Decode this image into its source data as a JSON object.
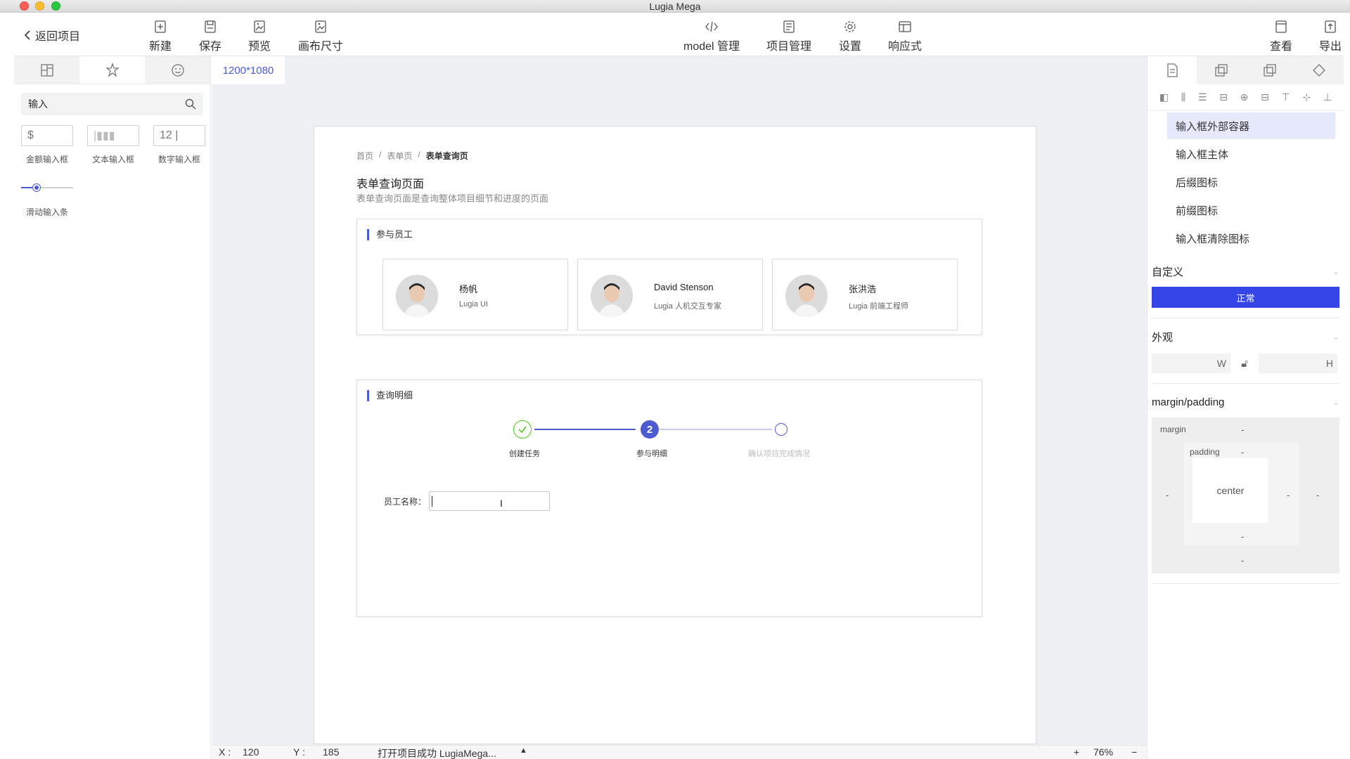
{
  "window": {
    "title": "Lugia Mega"
  },
  "toolbar": {
    "back_label": "返回项目",
    "left_items": [
      {
        "label": "新建",
        "icon": "new-file-icon"
      },
      {
        "label": "保存",
        "icon": "save-icon"
      },
      {
        "label": "预览",
        "icon": "preview-icon"
      },
      {
        "label": "画布尺寸",
        "icon": "canvas-size-icon"
      }
    ],
    "center_items": [
      {
        "label": "model 管理",
        "icon": "code-icon"
      },
      {
        "label": "项目管理",
        "icon": "project-icon"
      },
      {
        "label": "设置",
        "icon": "gear-icon"
      },
      {
        "label": "响应式",
        "icon": "layout-icon"
      }
    ],
    "right_items": [
      {
        "label": "查看",
        "icon": "view-icon"
      },
      {
        "label": "导出",
        "icon": "export-icon"
      }
    ]
  },
  "left_panel": {
    "tabs": [
      "grid-icon",
      "widget-icon",
      "smile-icon"
    ],
    "search": {
      "value": "输入"
    },
    "components": [
      {
        "preview": "$",
        "label": "金额输入框"
      },
      {
        "preview": "|▮▮▮",
        "label": "文本输入框"
      },
      {
        "preview": "12 |",
        "label": "数字输入框"
      }
    ],
    "slider": {
      "label": "滑动输入条",
      "value": 0.3
    }
  },
  "canvas": {
    "size_tab": "1200*1080",
    "breadcrumb": [
      "首页",
      "表单页",
      "表单查询页"
    ],
    "page_title": "表单查询页面",
    "page_desc": "表单查询页面是查询整体项目细节和进度的页面",
    "employees_card": {
      "title": "参与员工",
      "employees": [
        {
          "name": "杨帆",
          "role": "Lugia UI"
        },
        {
          "name": "David Stenson",
          "role": "Lugia 人机交互专家"
        },
        {
          "name": "张洪浩",
          "role": "Lugia 前端工程师"
        }
      ]
    },
    "detail_card": {
      "title": "查询明细",
      "steps": [
        {
          "label": "创建任务",
          "status": "done"
        },
        {
          "label": "参与明细",
          "status": "active",
          "number": "2"
        },
        {
          "label": "确认项目完成情况",
          "status": "wait"
        }
      ],
      "form": {
        "label": "员工名称：",
        "value": ""
      }
    }
  },
  "right_panel": {
    "tabs": [
      "page-icon",
      "copy-icon",
      "duplicate-icon",
      "diamond-icon"
    ],
    "parts": [
      "输入框外部容器",
      "输入框主体",
      "后缀图标",
      "前缀图标",
      "输入框清除图标"
    ],
    "selected_part_index": 0,
    "custom": {
      "title": "自定义",
      "status": "正常"
    },
    "appearance": {
      "title": "外观",
      "w_label": "W",
      "h_label": "H"
    },
    "box_model": {
      "title": "margin/padding",
      "margin_label": "margin",
      "padding_label": "padding",
      "content_label": "center",
      "empty": "-"
    }
  },
  "statusbar": {
    "x_label": "X :",
    "x_value": "120",
    "y_label": "Y :",
    "y_value": "185",
    "message": "打开项目成功 LugiaMega...",
    "zoom_in": "+",
    "zoom": "76%",
    "zoom_out": "−"
  },
  "colors": {
    "accent": "#4d5bd1",
    "primary_button": "#3545e8",
    "success": "#52c41a"
  }
}
